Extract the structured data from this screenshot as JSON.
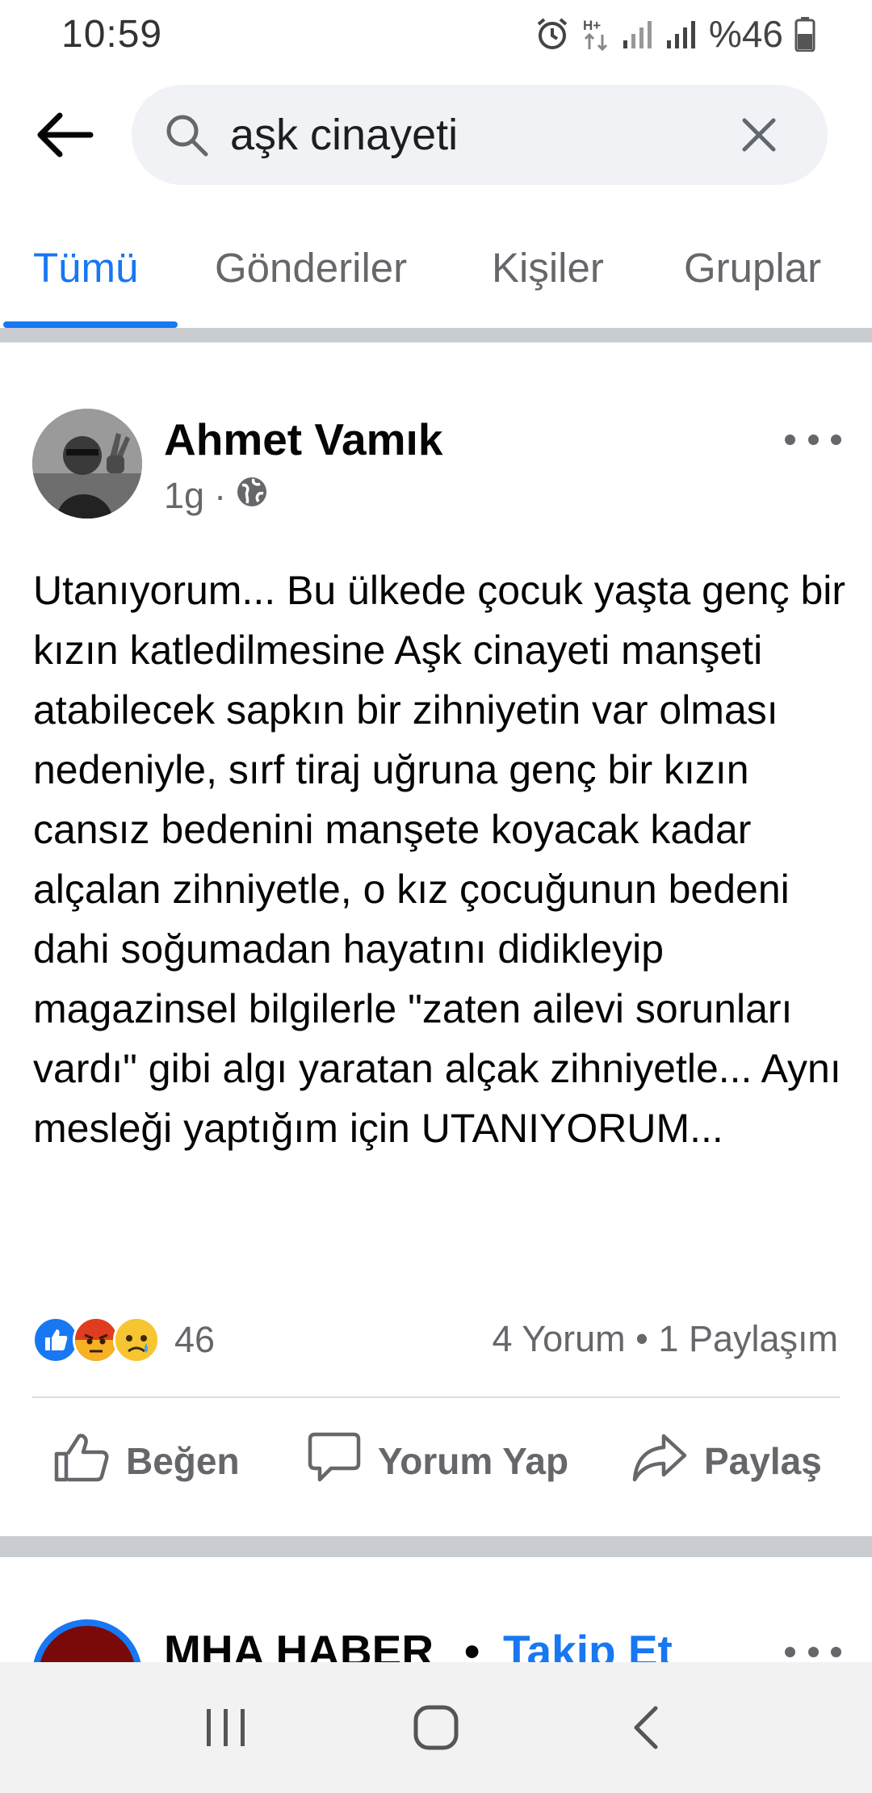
{
  "status_bar": {
    "time": "10:59",
    "battery": "%46",
    "icons": [
      "alarm-icon",
      "data-hplus-icon",
      "signal-icon",
      "signal-icon",
      "battery-icon"
    ]
  },
  "search": {
    "query": "aşk cinayeti",
    "back_icon": "back-arrow-icon",
    "search_icon": "search-icon",
    "clear_icon": "close-icon"
  },
  "tabs": [
    {
      "label": "Tümü",
      "active": true
    },
    {
      "label": "Gönderiler",
      "active": false
    },
    {
      "label": "Kişiler",
      "active": false
    },
    {
      "label": "Gruplar",
      "active": false
    }
  ],
  "post": {
    "author": "Ahmet Vamık",
    "time": "1g",
    "separator": "·",
    "privacy_icon": "globe-icon",
    "text": "Utanıyorum... Bu ülkede çocuk yaşta genç bir kızın katledilmesine Aşk cinayeti manşeti atabilecek sapkın bir zihniyetin var olması nedeniyle, sırf tiraj uğruna genç bir kızın cansız bedenini manşete koyacak kadar alçalan zihniyetle, o kız çocuğunun bedeni dahi soğumadan hayatını didikleyip magazinsel bilgilerle \"zaten ailevi sorunları vardı\" gibi algı yaratan alçak zihniyetle... Aynı mesleği yaptığım için UTANIYORUM...",
    "reaction_icons": [
      "like-reaction-icon",
      "angry-reaction-icon",
      "sad-reaction-icon"
    ],
    "reaction_count": "46",
    "engagement": "4 Yorum • 1 Paylaşım",
    "actions": {
      "like": "Beğen",
      "comment": "Yorum Yap",
      "share": "Paylaş"
    }
  },
  "post2": {
    "author": "MHA HABER",
    "separator": "•",
    "follow": "Takip Et"
  },
  "nav": {
    "recents_icon": "recents-icon",
    "home_icon": "home-icon",
    "back_icon": "nav-back-icon"
  },
  "colors": {
    "accent": "#1877f2",
    "secondary_text": "#65676b",
    "search_bg": "#f0f2f5",
    "divider": "#c9ccd1"
  }
}
